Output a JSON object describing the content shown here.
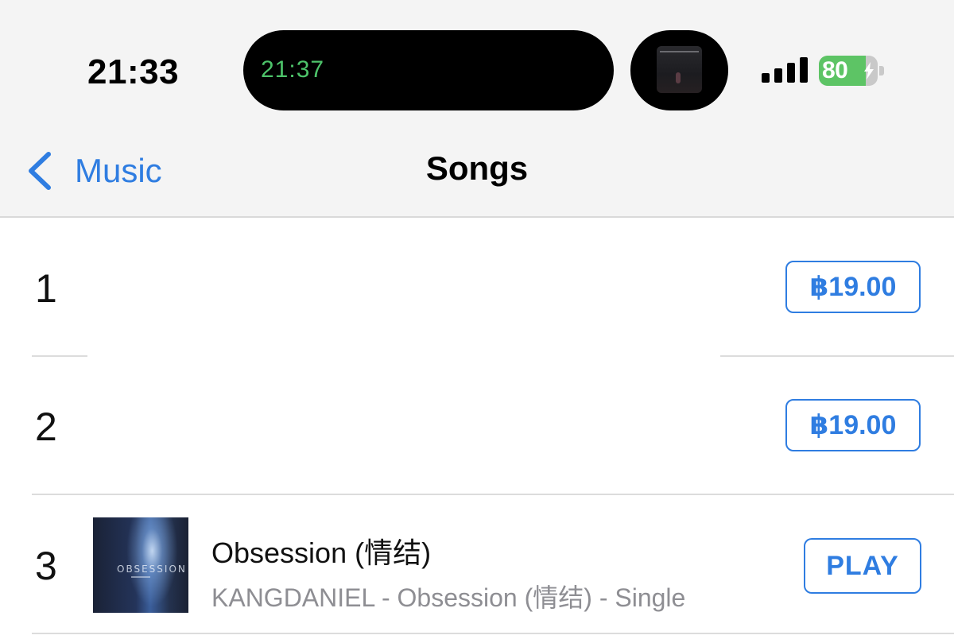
{
  "status_bar": {
    "time": "21:33",
    "live_activity_timer": "21:37",
    "battery_percent": "80",
    "battery_level": 0.8,
    "signal_bars": 4,
    "accent_green": "#4dc36a"
  },
  "nav": {
    "back_label": "Music",
    "title": "Songs",
    "accent": "#2f7de1"
  },
  "songs": [
    {
      "number": "1",
      "price": "฿19.00"
    },
    {
      "number": "2",
      "price": "฿19.00"
    },
    {
      "number": "3",
      "title": "Obsession (情结)",
      "subtitle": "KANGDANIEL - Obsession (情结) - Single",
      "action_label": "PLAY",
      "artwork_text": "OBSESSION"
    }
  ]
}
